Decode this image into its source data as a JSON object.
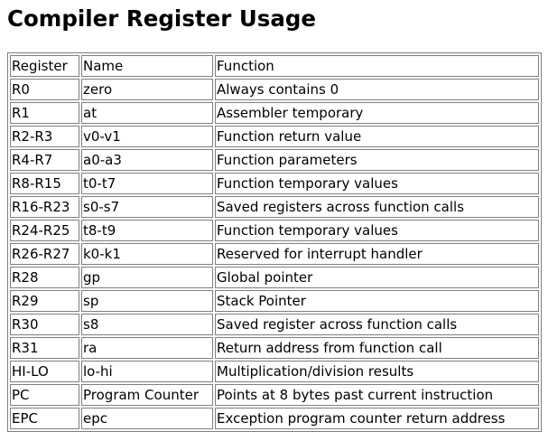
{
  "title": "Compiler Register Usage",
  "table": {
    "headers": [
      "Register",
      "Name",
      "Function"
    ],
    "rows": [
      [
        "R0",
        "zero",
        "Always contains 0"
      ],
      [
        "R1",
        "at",
        "Assembler temporary"
      ],
      [
        "R2-R3",
        "v0-v1",
        "Function return value"
      ],
      [
        "R4-R7",
        "a0-a3",
        "Function parameters"
      ],
      [
        "R8-R15",
        "t0-t7",
        "Function temporary values"
      ],
      [
        "R16-R23",
        "s0-s7",
        "Saved registers across function calls"
      ],
      [
        "R24-R25",
        "t8-t9",
        "Function temporary values"
      ],
      [
        "R26-R27",
        "k0-k1",
        "Reserved for interrupt handler"
      ],
      [
        "R28",
        "gp",
        "Global pointer"
      ],
      [
        "R29",
        "sp",
        "Stack Pointer"
      ],
      [
        "R30",
        "s8",
        "Saved register across function calls"
      ],
      [
        "R31",
        "ra",
        "Return address from function call"
      ],
      [
        "HI-LO",
        "lo-hi",
        "Multiplication/division results"
      ],
      [
        "PC",
        "Program Counter",
        "Points at 8 bytes past current instruction"
      ],
      [
        "EPC",
        "epc",
        "Exception program counter return address"
      ]
    ]
  }
}
